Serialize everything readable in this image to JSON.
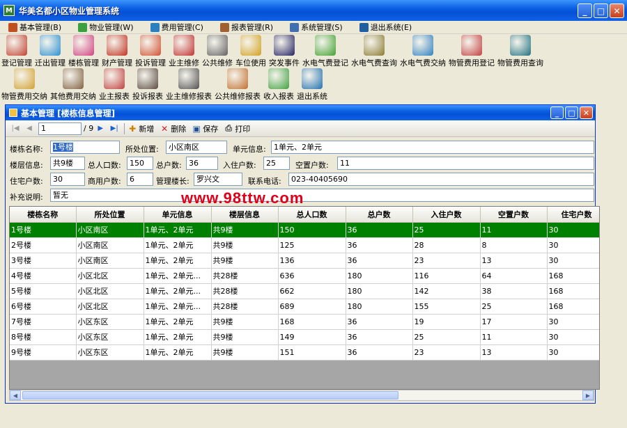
{
  "app": {
    "title": "华美名都小区物业管理系统"
  },
  "menu": [
    {
      "label": "基本管理(B)",
      "color": "#c05020"
    },
    {
      "label": "物业管理(W)",
      "color": "#3aa040"
    },
    {
      "label": "费用管理(C)",
      "color": "#2a7fc0"
    },
    {
      "label": "报表管理(R)",
      "color": "#a06030"
    },
    {
      "label": "系统管理(S)",
      "color": "#4070b0"
    },
    {
      "label": "退出系统(E)",
      "color": "#2060a0"
    }
  ],
  "toolbar_row1": [
    {
      "label": "登记管理",
      "icon": "register-icon",
      "color": "#c04030"
    },
    {
      "label": "迁出管理",
      "icon": "moveout-icon",
      "color": "#2a8fd0"
    },
    {
      "label": "楼栋管理",
      "icon": "building-icon",
      "color": "#d04080"
    },
    {
      "label": "财产管理",
      "icon": "house-icon",
      "color": "#c03020"
    },
    {
      "label": "投诉管理",
      "icon": "complaint-icon",
      "color": "#d05030"
    },
    {
      "label": "业主维修",
      "icon": "tools-icon",
      "color": "#c03030"
    },
    {
      "label": "公共维修",
      "icon": "wrench-icon",
      "color": "#606060"
    },
    {
      "label": "车位使用",
      "icon": "truck-icon",
      "color": "#d0a020"
    },
    {
      "label": "突发事件",
      "icon": "alarm-icon",
      "color": "#202060"
    },
    {
      "label": "水电气费登记",
      "icon": "meter-icon",
      "color": "#40a030"
    },
    {
      "label": "水电气费查询",
      "icon": "search-meter-icon",
      "color": "#8a7a30"
    },
    {
      "label": "水电气费交纳",
      "icon": "pay-meter-icon",
      "color": "#3080c0"
    },
    {
      "label": "物管费用登记",
      "icon": "fee-register-icon",
      "color": "#c04040"
    },
    {
      "label": "物管费用查询",
      "icon": "fee-search-icon",
      "color": "#207080"
    }
  ],
  "toolbar_row2": [
    {
      "label": "物管费用交纳",
      "icon": "fee-pay-icon",
      "color": "#d0a030"
    },
    {
      "label": "其他费用交纳",
      "icon": "other-fee-icon",
      "color": "#806040"
    },
    {
      "label": "业主报表",
      "icon": "owner-report-icon",
      "color": "#c04040"
    },
    {
      "label": "投诉报表",
      "icon": "complaint-report-icon",
      "color": "#5a4a40"
    },
    {
      "label": "业主维修报表",
      "icon": "repair-report-icon",
      "color": "#505050"
    },
    {
      "label": "公共维修报表",
      "icon": "public-report-icon",
      "color": "#c07030"
    },
    {
      "label": "收入报表",
      "icon": "income-report-icon",
      "color": "#40a040"
    },
    {
      "label": "退出系统",
      "icon": "exit-icon",
      "color": "#2070b0"
    }
  ],
  "subwindow": {
    "title": "基本管理 [楼栋信息管理]"
  },
  "nav": {
    "position": "1",
    "total": "/ 9",
    "add": "新增",
    "delete": "删除",
    "save": "保存",
    "print": "打印"
  },
  "form": {
    "building_name_label": "楼栋名称:",
    "building_name": "1号楼",
    "location_label": "所处位置:",
    "location": "小区南区",
    "unit_label": "单元信息:",
    "unit": "1单元、2单元",
    "floor_label": "楼层信息:",
    "floor": "共9楼",
    "population_label": "总人口数:",
    "population": "150",
    "households_label": "总户数:",
    "households": "36",
    "occupied_label": "入住户数:",
    "occupied": "25",
    "vacant_label": "空置户数:",
    "vacant": "11",
    "residential_label": "住宅户数:",
    "residential": "30",
    "commercial_label": "商用户数:",
    "commercial": "6",
    "manager_label": "管理楼长:",
    "manager": "罗兴文",
    "phone_label": "联系电话:",
    "phone": "023-40405690",
    "note_label": "补充说明:",
    "note": "暂无"
  },
  "watermark": "www.98ttw.com",
  "table": {
    "headers": [
      "楼栋名称",
      "所处位置",
      "单元信息",
      "楼层信息",
      "总人口数",
      "总户数",
      "入住户数",
      "空置户数",
      "住宅户数"
    ],
    "rows": [
      [
        "1号楼",
        "小区南区",
        "1单元、2单元",
        "共9楼",
        "150",
        "36",
        "25",
        "11",
        "30"
      ],
      [
        "2号楼",
        "小区南区",
        "1单元、2单元",
        "共9楼",
        "125",
        "36",
        "28",
        "8",
        "30"
      ],
      [
        "3号楼",
        "小区南区",
        "1单元、2单元",
        "共9楼",
        "136",
        "36",
        "23",
        "13",
        "30"
      ],
      [
        "4号楼",
        "小区北区",
        "1单元、2单元...",
        "共28楼",
        "636",
        "180",
        "116",
        "64",
        "168"
      ],
      [
        "5号楼",
        "小区北区",
        "1单元、2单元...",
        "共28楼",
        "662",
        "180",
        "142",
        "38",
        "168"
      ],
      [
        "6号楼",
        "小区北区",
        "1单元、2单元...",
        "共28楼",
        "689",
        "180",
        "155",
        "25",
        "168"
      ],
      [
        "7号楼",
        "小区东区",
        "1单元、2单元",
        "共9楼",
        "168",
        "36",
        "19",
        "17",
        "30"
      ],
      [
        "8号楼",
        "小区东区",
        "1单元、2单元",
        "共9楼",
        "149",
        "36",
        "25",
        "11",
        "30"
      ],
      [
        "9号楼",
        "小区东区",
        "1单元、2单元",
        "共9楼",
        "151",
        "36",
        "23",
        "13",
        "30"
      ]
    ],
    "selected_row": 0,
    "selected_color": "#008000"
  }
}
